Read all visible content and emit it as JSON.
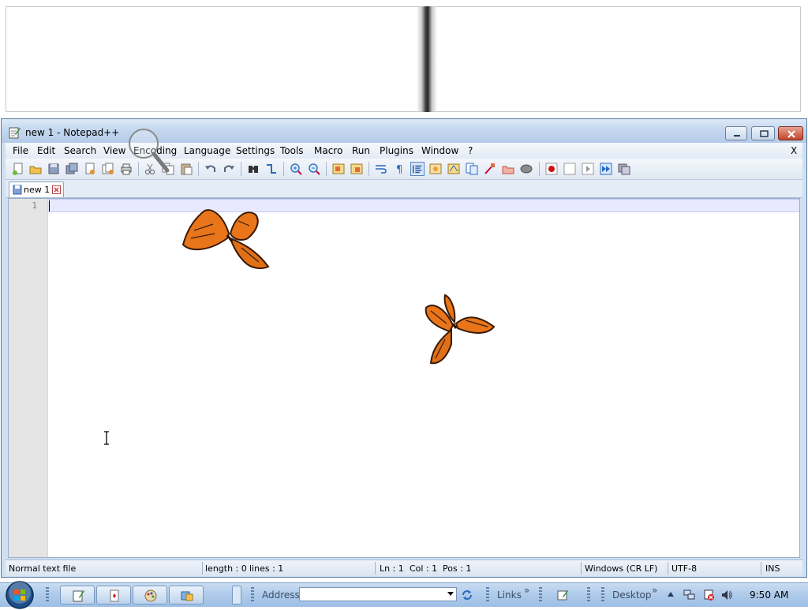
{
  "window": {
    "title": "new 1 - Notepad++",
    "menu": [
      "File",
      "Edit",
      "Search",
      "View",
      "Encoding",
      "Language",
      "Settings",
      "Tools",
      "Macro",
      "Run",
      "Plugins",
      "Window",
      "?"
    ],
    "menu_close": "X"
  },
  "tabs": [
    {
      "label": "new 1"
    }
  ],
  "editor": {
    "line_numbers": [
      "1"
    ]
  },
  "statusbar": {
    "file_type": "Normal text file",
    "length": "length : 0",
    "lines": "lines : 1",
    "ln": "Ln : 1",
    "col": "Col : 1",
    "pos": "Pos : 1",
    "eol": "Windows (CR LF)",
    "encoding": "UTF-8",
    "mode": "INS"
  },
  "taskbar": {
    "address_label": "Address",
    "links_label": "Links",
    "desktop_label": "Desktop",
    "chevron": "»",
    "clock": "9:50 AM"
  },
  "colors": {
    "title_bar": "#c2d6ee",
    "current_line": "#e8e8ff",
    "butterfly": "#e8751a"
  }
}
